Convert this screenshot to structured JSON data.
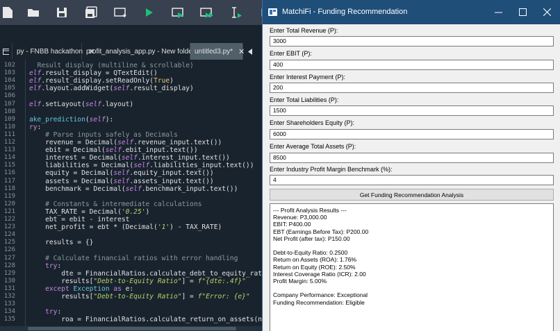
{
  "ide": {
    "tabs": [
      {
        "label": "py - FNBB hackathon",
        "close": "✕"
      },
      {
        "label": "profit_analysis_app.py - New folder",
        "close": "✕"
      },
      {
        "label": "untitled3.py*",
        "close": "✕"
      }
    ],
    "line_numbers": [
      "102",
      "103",
      "104",
      "105",
      "106",
      "107",
      "108",
      "109",
      "110",
      "111",
      "112",
      "113",
      "114",
      "115",
      "116",
      "117",
      "118",
      "119",
      "120",
      "121",
      "122",
      "123",
      "124",
      "125",
      "126",
      "127",
      "128",
      "129",
      "130",
      "131",
      "132",
      "133",
      "134",
      "135"
    ]
  },
  "dialog": {
    "title": "MatchiFi - Funding Recommendation",
    "fields": [
      {
        "label": "Enter Total Revenue (P):",
        "value": "3000"
      },
      {
        "label": "Enter EBIT (P):",
        "value": "400"
      },
      {
        "label": "Enter Interest Payment (P):",
        "value": "200"
      },
      {
        "label": "Enter Total Liabilities (P):",
        "value": "1500"
      },
      {
        "label": "Enter Shareholders Equity (P):",
        "value": "6000"
      },
      {
        "label": "Enter Average Total Assets (P):",
        "value": "8500"
      },
      {
        "label": "Enter Industry Profit Margin Benchmark (%):",
        "value": "4"
      }
    ],
    "button_label": "Get Funding Recommendation  Analysis",
    "results": [
      "--- Profit Analysis Results ---",
      "Revenue: P3,000.00",
      "EBIT: P400.00",
      "EBT (Earnings Before Tax): P200.00",
      "Net Profit (after tax): P150.00",
      "",
      "Debt-to-Equity Ratio: 0.2500",
      "Return on Assets (ROA): 1.76%",
      "Return on Equity (ROE): 2.50%",
      "Interest Coverage Ratio (ICR): 2.00",
      "Profit Margin: 5.00%",
      "",
      "Company Performance: Exceptional",
      "Funding Recommendation: Eligible"
    ]
  },
  "icons": [
    "folder-icon",
    "save-icon",
    "save-all-icon",
    "new-cell-icon",
    "run-icon",
    "run-cell-icon",
    "run-cell-advance-icon",
    "run-selection-icon",
    "app-icon",
    "minimize-icon",
    "maximize-icon",
    "close-icon"
  ]
}
